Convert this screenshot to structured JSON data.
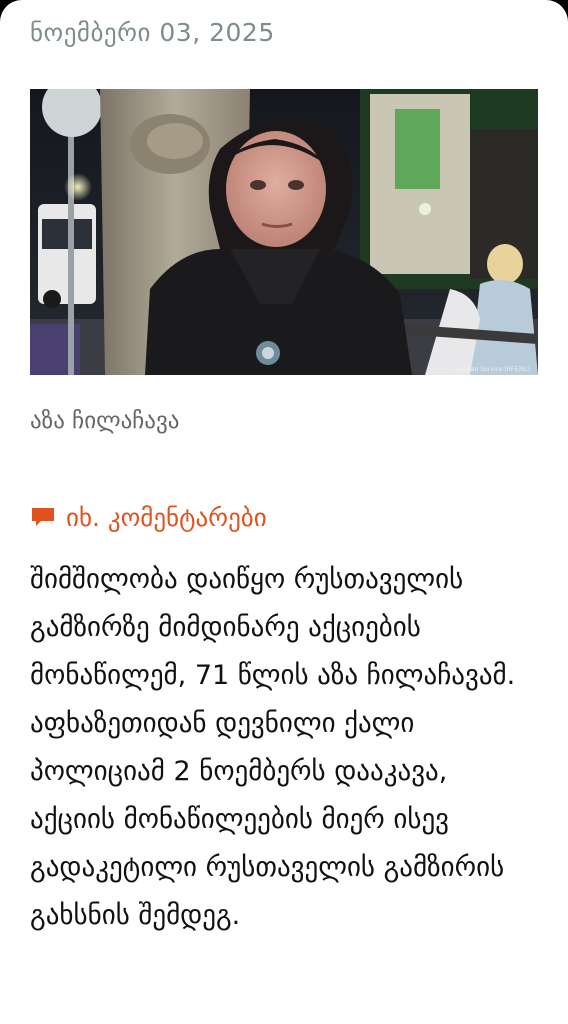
{
  "post": {
    "date": "ნოემბერი 03, 2025",
    "photo": {
      "alt_icon": "photo-woman-portrait",
      "credit": "Georgian Service (RFE/RL)"
    },
    "caption": "აზა ჩილაჩავა",
    "comments_link": {
      "icon": "comment-icon",
      "label": "იხ. კომენტარები",
      "color": "#e0531f"
    },
    "body": "შიმშილობა დაიწყო რუსთაველის გამზირზე მიმდინარე აქციების მონაწილემ, 71 წლის აზა ჩილაჩავამ. აფხაზეთიდან დევნილი ქალი პოლიციამ 2 ნოემბერს დააკავა, აქციის მონაწილეების მიერ ისევ გადაკეტილი რუსთაველის გამზირის გახსნის შემდეგ."
  }
}
